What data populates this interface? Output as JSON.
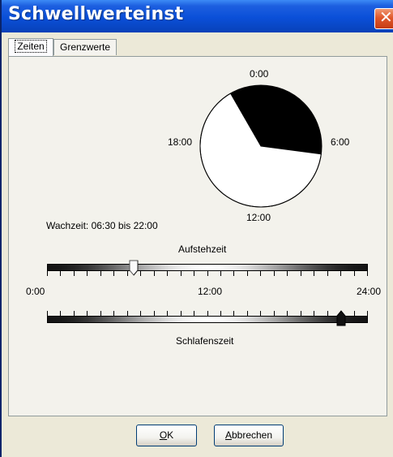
{
  "window": {
    "title": "Schwellwerteinst",
    "close_glyph": "✕",
    "title_bar_color": "#0a4fd8",
    "close_button_color": "#e0582c"
  },
  "tabs": [
    {
      "label": "Zeiten",
      "active": true
    },
    {
      "label": "Grenzwerte",
      "active": false
    }
  ],
  "clock": {
    "labels": {
      "top": "0:00",
      "right": "6:00",
      "bottom": "12:00",
      "left": "18:00"
    },
    "night_start_hour": 22.0,
    "night_end_hour": 6.5,
    "night_color": "#000000",
    "day_color": "#ffffff"
  },
  "wake_summary": "Wachzeit: 06:30 bis 22:00",
  "aufsteh_slider": {
    "label": "Aufstehzeit",
    "value_hour": 6.5,
    "min_hour": 0,
    "max_hour": 24
  },
  "scale_labels": {
    "start": "0:00",
    "middle": "12:00",
    "end": "24:00"
  },
  "schlafens_slider": {
    "label": "Schlafenszeit",
    "value_hour": 22.0,
    "min_hour": 0,
    "max_hour": 24
  },
  "buttons": {
    "ok": {
      "mnemonic": "O",
      "rest": "K"
    },
    "cancel": {
      "mnemonic": "A",
      "rest": "bbrechen"
    }
  }
}
